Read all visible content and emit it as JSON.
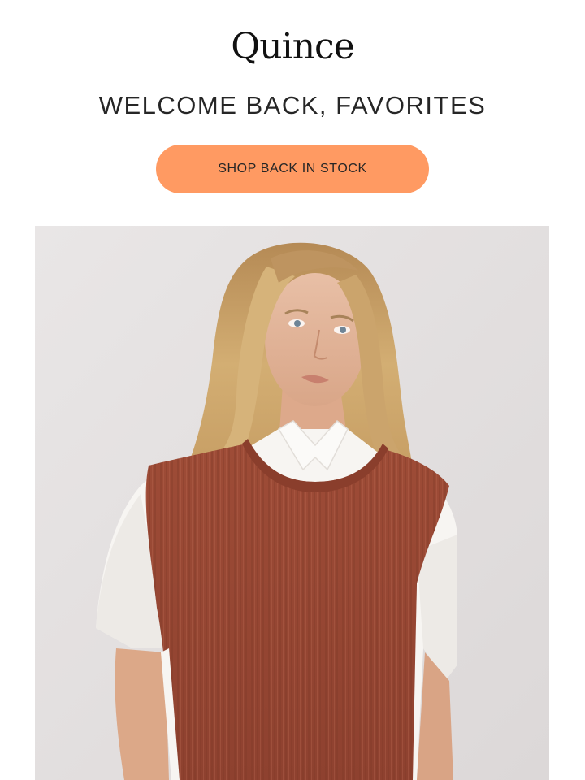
{
  "brand": {
    "logo_text": "Quince"
  },
  "hero": {
    "headline": "WELCOME BACK, FAVORITES",
    "cta_label": "SHOP BACK IN STOCK"
  },
  "product_image": {
    "alt": "Model wearing a rust knit sweater vest over a white button-up shirt"
  },
  "colors": {
    "cta_background": "#FF9A62",
    "image_background": "#E4E1E1",
    "sweater": "#A14E39",
    "shirt": "#F7F5F2",
    "hair": "#C9A166"
  },
  "icons": {
    "logo": "quince-wordmark"
  }
}
